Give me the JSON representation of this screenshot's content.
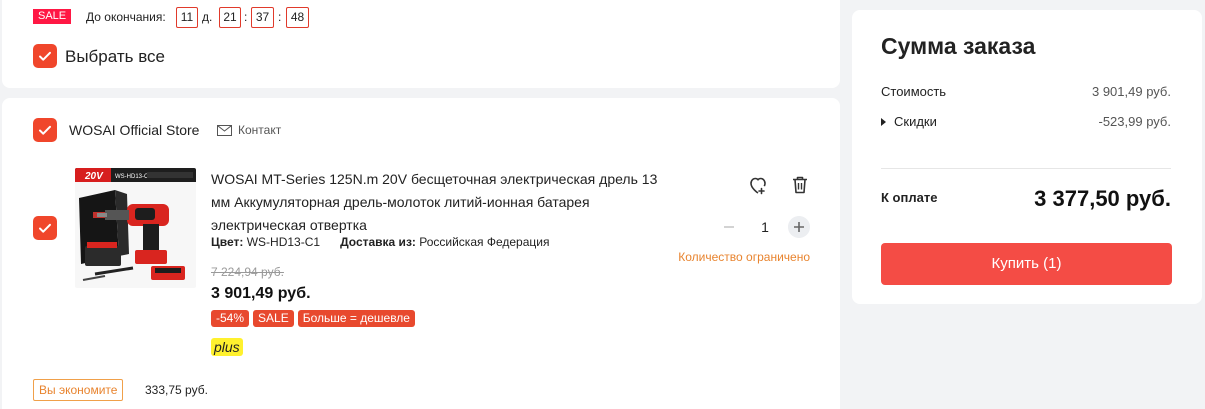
{
  "countdown": {
    "sale_label": "SALE",
    "label": "До окончания:",
    "days": "11",
    "days_suffix": "д.",
    "hours": "21",
    "minutes": "37",
    "seconds": "48",
    "separator": ":"
  },
  "select_all": {
    "label": "Выбрать все",
    "checked": true
  },
  "store": {
    "name": "WOSAI Official Store",
    "contact_label": "Контакт",
    "checked": true
  },
  "product": {
    "checked": true,
    "image_brand": "20V",
    "image_model": "WS-HD13-C1",
    "title": "WOSAI MT-Series 125N.m 20V бесщеточная электрическая дрель 13 мм Аккумуляторная дрель-молоток литий-ионная батарея электрическая отвертка",
    "color_label": "Цвет:",
    "color_value": "WS-HD13-C1",
    "delivery_label": "Доставка из:",
    "delivery_value": "Российская Федерация",
    "old_price": "7 224,94 руб.",
    "price": "3 901,49 руб.",
    "badges": [
      "-54%",
      "SALE",
      "Больше = дешевле"
    ],
    "plus_label": "plus",
    "quantity": "1",
    "limited_text": "Количество ограничено"
  },
  "savings": {
    "label": "Вы экономите",
    "value": "333,75 руб."
  },
  "summary": {
    "title": "Сумма заказа",
    "cost_label": "Стоимость",
    "cost_value": "3 901,49 руб.",
    "discount_label": "Скидки",
    "discount_value": "-523,99 руб.",
    "pay_label": "К оплате",
    "pay_total": "3 377,50 руб.",
    "buy_label": "Купить (1)"
  },
  "colors": {
    "accent": "#f0462b",
    "buy_button": "#f44c45",
    "sale_badge": "#ff1744",
    "limited_text": "#e8842f",
    "plus_bg": "#fff12e"
  }
}
